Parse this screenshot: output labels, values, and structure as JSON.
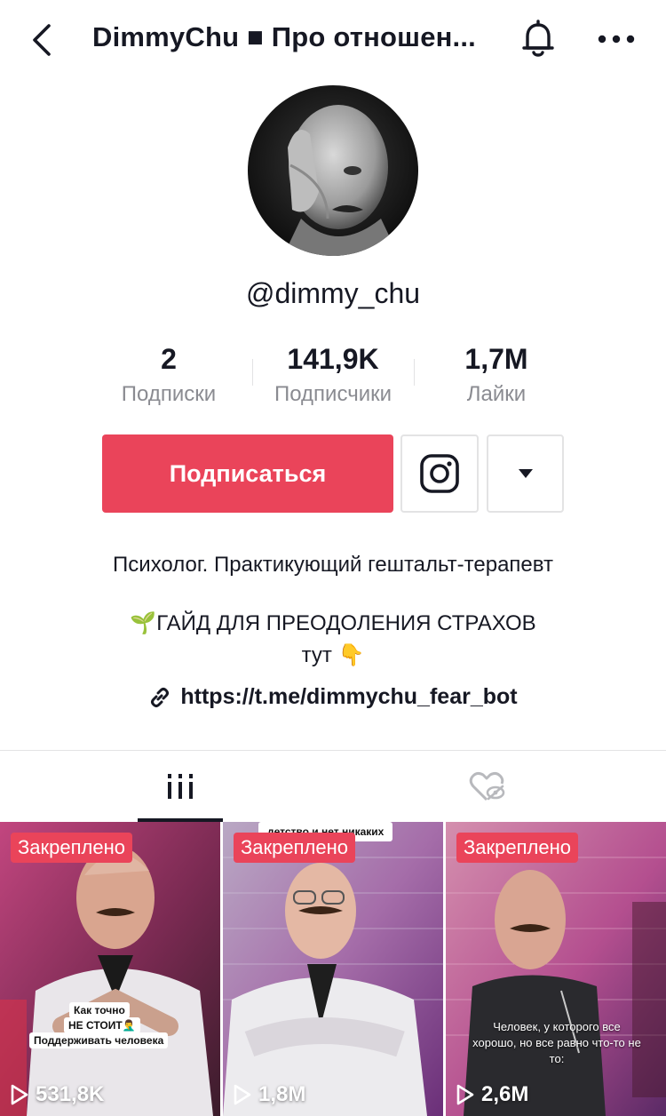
{
  "header": {
    "title": "DimmyChu ■ Про отношен..."
  },
  "profile": {
    "username": "@dimmy_chu",
    "stats": [
      {
        "value": "2",
        "label": "Подписки"
      },
      {
        "value": "141,9K",
        "label": "Подписчики"
      },
      {
        "value": "1,7M",
        "label": "Лайки"
      }
    ],
    "follow_label": "Подписаться",
    "bio_line1": "Психолог. Практикующий гештальт-терапевт",
    "bio_line2": "🌱ГАЙД ДЛЯ ПРЕОДОЛЕНИЯ СТРАХОВ",
    "bio_line3": "тут 👇",
    "link": "https://t.me/dimmychu_fear_bot"
  },
  "videos": [
    {
      "pinned_label": "Закреплено",
      "views": "531,8K",
      "captions": [
        "Как точно",
        "НЕ СТОИТ🤦‍♂️",
        "Поддерживать человека"
      ]
    },
    {
      "pinned_label": "Закреплено",
      "views": "1,8M",
      "top_caption": "детство и нет никаких"
    },
    {
      "pinned_label": "Закреплено",
      "views": "2,6M",
      "caption": "Человек, у которого все хорошо, но все равно что-то не то:"
    }
  ],
  "colors": {
    "accent": "#ea445a",
    "text": "#161823",
    "muted": "#8a8b91"
  }
}
